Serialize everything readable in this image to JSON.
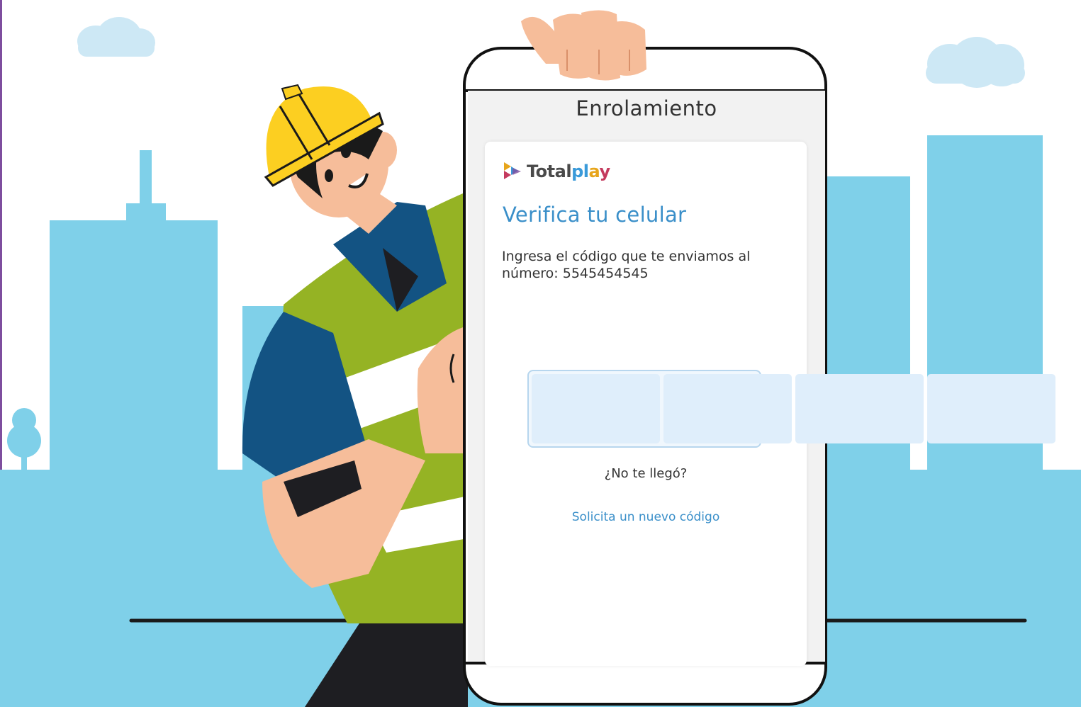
{
  "phone": {
    "title": "Enrolamiento"
  },
  "brand": {
    "total": "Total",
    "play_letters": [
      {
        "ch": "p",
        "color": "#3a9ad9"
      },
      {
        "ch": "l",
        "color": "#3a9ad9"
      },
      {
        "ch": "a",
        "color": "#e7a51b"
      },
      {
        "ch": "y",
        "color": "#c43a5e"
      }
    ],
    "logo_icon": "totalplay-triangles-icon"
  },
  "verify": {
    "heading": "Verifica tu celular",
    "instructions": "Ingresa el código que te enviamos al número: 5545454545",
    "code_digits": [
      "",
      "",
      "",
      ""
    ],
    "resend_question": "¿No te llegó?",
    "resend_link": "Solicita un nuevo código"
  },
  "colors": {
    "accent": "#3a8fc9",
    "sky_building": "#7fd0e9",
    "cloud": "#cde8f5",
    "vest_green": "#95b324",
    "shirt_blue": "#135383",
    "helmet_yellow": "#fccf21",
    "skin": "#f6bd9a"
  }
}
